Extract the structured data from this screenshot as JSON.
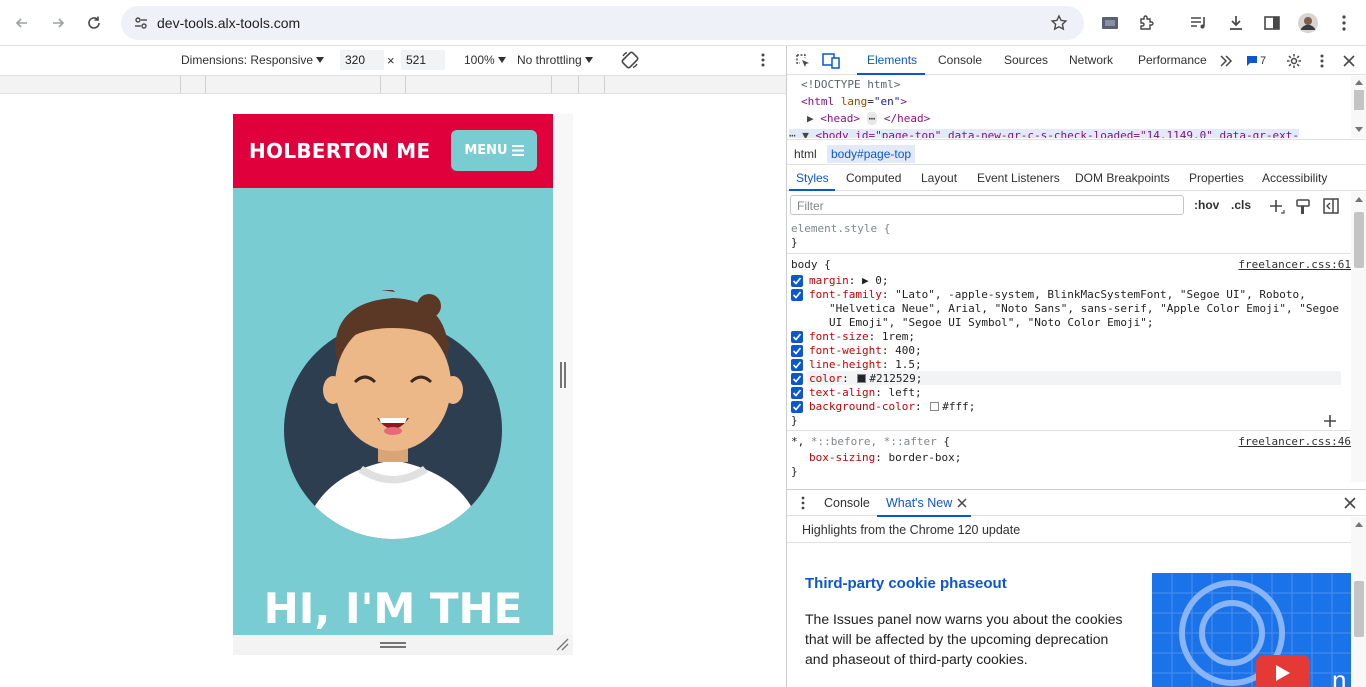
{
  "browser": {
    "url": "dev-tools.alx-tools.com"
  },
  "device_toolbar": {
    "dimensions_label": "Dimensions: Responsive",
    "width": "320",
    "times": "×",
    "height": "521",
    "zoom": "100%",
    "throttling": "No throttling"
  },
  "site": {
    "brand": "HOLBERTON ME",
    "menu_label": "MENU",
    "hero_text": "HI, I'M THE",
    "colors": {
      "nav_bg": "#e0003b",
      "hero_bg": "#79ccd2"
    }
  },
  "devtools": {
    "tabs": [
      "Elements",
      "Console",
      "Sources",
      "Network",
      "Performance"
    ],
    "issues_count": "7",
    "dom": {
      "doctype": "<!DOCTYPE html>",
      "html_open_tag": "<html",
      "html_attr_name": "lang",
      "html_attr_value": "\"en\"",
      "html_close": ">",
      "head_open": "<head>",
      "head_ellipsis": "⋯",
      "head_close": "</head>",
      "body_line": "<body id=\"page-top\" data-new-gr-c-s-check-loaded=\"14.1149.0\" data-gr-ext-"
    },
    "breadcrumbs": [
      "html",
      "body#page-top"
    ],
    "style_tabs": [
      "Styles",
      "Computed",
      "Layout",
      "Event Listeners",
      "DOM Breakpoints",
      "Properties",
      "Accessibility"
    ],
    "filter_placeholder": "Filter",
    "filter_hov": ":hov",
    "filter_cls": ".cls",
    "styles": {
      "element_style_open": "element.style {",
      "close_brace": "}",
      "body_selector": "body {",
      "body_source": "freelancer.css:61",
      "props": [
        {
          "name": "margin",
          "value": "▶ 0;"
        },
        {
          "name": "font-family",
          "value": "\"Lato\", -apple-system, BlinkMacSystemFont, \"Segoe UI\", Roboto,"
        },
        {
          "name": "font-size",
          "value": "1rem;"
        },
        {
          "name": "font-weight",
          "value": "400;"
        },
        {
          "name": "line-height",
          "value": "1.5;"
        },
        {
          "name": "color",
          "value": "#212529;"
        },
        {
          "name": "text-align",
          "value": "left;"
        },
        {
          "name": "background-color",
          "value": "#fff;"
        }
      ],
      "font_family_cont1": "\"Helvetica Neue\", Arial, \"Noto Sans\", sans-serif, \"Apple Color Emoji\", \"Segoe",
      "font_family_cont2": "UI Emoji\", \"Segoe UI Symbol\", \"Noto Color Emoji\";",
      "universal_selector_a": "*, ",
      "universal_selector_b": "*::before, *::after",
      "universal_selector_c": " {",
      "universal_source": "freelancer.css:46",
      "box_sizing_name": "box-sizing",
      "box_sizing_value": "border-box;"
    },
    "drawer": {
      "tabs": [
        "Console",
        "What's New"
      ],
      "highlights": "Highlights from the Chrome 120 update",
      "title": "Third-party cookie phaseout",
      "body": "The Issues panel now warns you about the cookies that will be affected by the upcoming deprecation and phaseout of third-party cookies."
    }
  }
}
